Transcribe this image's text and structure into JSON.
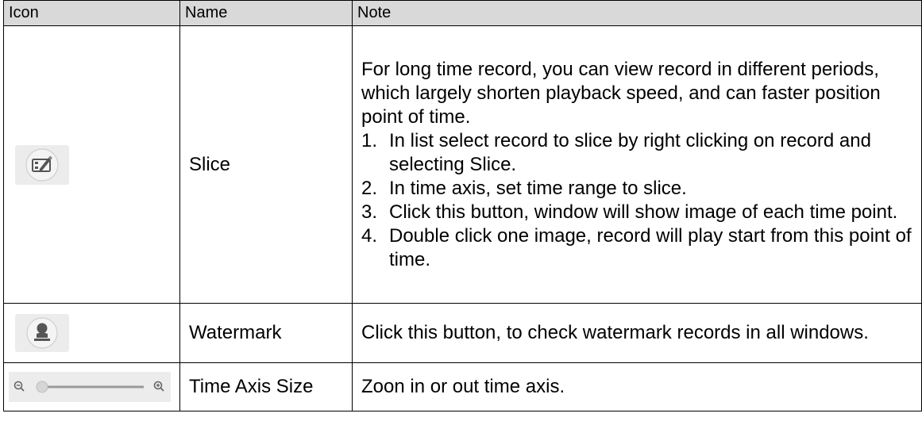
{
  "table": {
    "headers": {
      "icon": "Icon",
      "name": "Name",
      "note": "Note"
    },
    "rows": [
      {
        "icon": "slice-icon",
        "name": "Slice",
        "note_intro": "For long time record, you can view record in different periods, which largely shorten playback speed, and can faster position point of time.",
        "steps": [
          {
            "num": "1.",
            "text": "In list select record to slice by right clicking on record and selecting Slice."
          },
          {
            "num": "2.",
            "text": "In time axis, set time range to slice."
          },
          {
            "num": "3.",
            "text": "Click this button, window will show image of each time point."
          },
          {
            "num": "4.",
            "text": "Double click one image, record will play start from this point of time."
          }
        ]
      },
      {
        "icon": "watermark-icon",
        "name": "Watermark",
        "note": "Click this button, to check watermark records in  all windows."
      },
      {
        "icon": "time-axis-zoom-slider",
        "name": "Time Axis Size",
        "note": "Zoon in or out time axis."
      }
    ]
  },
  "colors": {
    "header_bg": "#d9d9d9",
    "border": "#000000",
    "icon_bg": "#ececec"
  }
}
